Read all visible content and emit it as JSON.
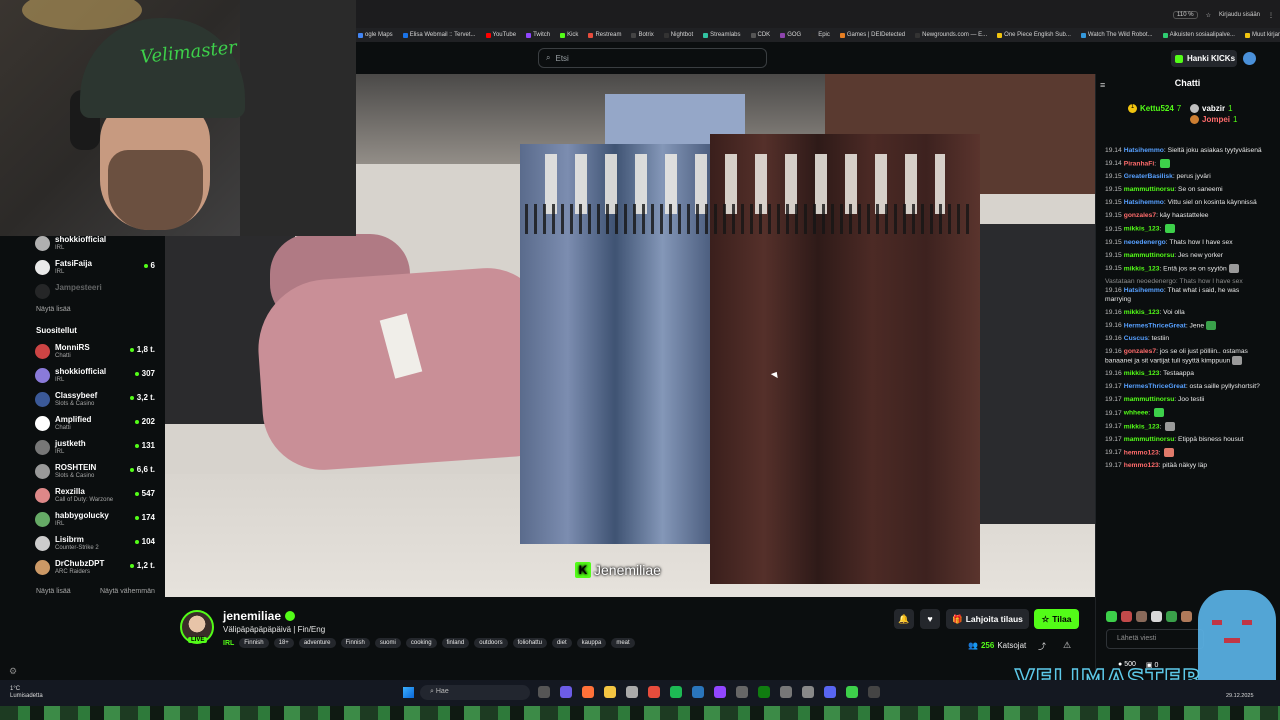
{
  "browser": {
    "zoom": "110 %",
    "signin": "Kirjaudu sisään",
    "bookmarks": [
      "ogle Maps",
      "Elisa Webmail :: Tervet...",
      "YouTube",
      "Twitch",
      "Kick",
      "Restream",
      "Botrix",
      "Nightbot",
      "Streamlabs",
      "CDK",
      "GOG",
      "Epic",
      "Games | DEIDetected",
      "Newgrounds.com — E...",
      "One Piece English Sub...",
      "Watch The Wild Robot...",
      "Aikuisten sosiaalipalve...",
      "Muut kirjanmerkit"
    ]
  },
  "header": {
    "search_placeholder": "Etsi",
    "get_kicks": "Hanki KICKs"
  },
  "webcam": {
    "logo_text": "Velimaster"
  },
  "sidebar": {
    "following": [
      {
        "name": "shokkiofficial",
        "category": "IRL",
        "count": ""
      },
      {
        "name": "FatsiFaija",
        "category": "IRL",
        "count": "6"
      },
      {
        "name": "Jampesteeri",
        "category": "",
        "count": ""
      }
    ],
    "show_more_1": "Näytä lisää",
    "recommended_title": "Suositellut",
    "recommended": [
      {
        "name": "MonniRS",
        "category": "Chatti",
        "count": "1,8 t."
      },
      {
        "name": "shokkiofficial",
        "category": "IRL",
        "count": "307"
      },
      {
        "name": "Classybeef",
        "category": "Slots & Casino",
        "count": "3,2 t."
      },
      {
        "name": "Amplified",
        "category": "Chatti",
        "count": "202"
      },
      {
        "name": "justketh",
        "category": "IRL",
        "count": "131"
      },
      {
        "name": "ROSHTEIN",
        "category": "Slots & Casino",
        "count": "6,6 t."
      },
      {
        "name": "Rexzilla",
        "category": "Call of Duty: Warzone",
        "count": "547"
      },
      {
        "name": "habbygolucky",
        "category": "IRL",
        "count": "174"
      },
      {
        "name": "Lisibrm",
        "category": "Counter-Strike 2",
        "count": "104"
      },
      {
        "name": "DrChubzDPT",
        "category": "ARC Raiders",
        "count": "1,2 t."
      }
    ],
    "show_more_2": "Näytä lisää",
    "show_less": "Näytä vähemmän"
  },
  "video": {
    "watermark": "Jenemiliae"
  },
  "stream": {
    "live_badge": "LIVE",
    "streamer": "jenemiliae",
    "title": "Välipäpäpäpäpäivä | Fin/Eng",
    "category": "IRL",
    "tags": [
      "Finnish",
      "18+",
      "adventure",
      "Finnish",
      "suomi",
      "cooking",
      "finland",
      "outdoors",
      "foliohattu",
      "diet",
      "kauppa",
      "meat"
    ],
    "gift_label": "Lahjoita tilaus",
    "subscribe_label": "Tilaa",
    "viewers_count": "256",
    "viewers_label": "Katsojat"
  },
  "chat": {
    "title": "Chatti",
    "pinned": [
      {
        "rank": "1",
        "name": "Kettu524",
        "score": "7"
      },
      {
        "rank": "",
        "name": "vabzir",
        "score": "1"
      },
      {
        "rank": "",
        "name": "Jompei",
        "score": "1"
      }
    ],
    "messages": [
      {
        "time": "19.14",
        "user": "Hatsihemmo",
        "color": "#57a0ff",
        "text": "Sieltä joku asiakas tyytyväisenä",
        "emote": ""
      },
      {
        "time": "19.14",
        "user": "PiranhaFi",
        "color": "#ff6b6b",
        "text": "",
        "emote": "#3dd04a"
      },
      {
        "time": "19.15",
        "user": "GreaterBasilisk",
        "color": "#57a0ff",
        "text": "perus jyväri",
        "emote": ""
      },
      {
        "time": "19.15",
        "user": "mammuttinorsu",
        "color": "#53fc18",
        "text": "Se on saneemi",
        "emote": ""
      },
      {
        "time": "19.15",
        "user": "Hatsihemmo",
        "color": "#57a0ff",
        "text": "Vittu siel on kosinta käynnissä",
        "emote": ""
      },
      {
        "time": "19.15",
        "user": "gonzales7",
        "color": "#ff6b6b",
        "text": "käy haastattelee",
        "emote": ""
      },
      {
        "time": "19.15",
        "user": "mikkis_123",
        "color": "#53fc18",
        "text": "",
        "emote": "#3dd04a"
      },
      {
        "time": "19.15",
        "user": "neoedenergo",
        "color": "#57a0ff",
        "text": "Thats how I have sex",
        "emote": ""
      },
      {
        "time": "19.15",
        "user": "mammuttinorsu",
        "color": "#53fc18",
        "text": "Jes new yorker",
        "emote": ""
      },
      {
        "time": "19.15",
        "user": "mikkis_123",
        "color": "#53fc18",
        "text": "Entä jos se on syytön",
        "emote": "#9a9a9a"
      },
      {
        "time": "",
        "user": "",
        "color": "#8d8d8d",
        "text": "Vastataan neoedenergo: Thats how I have sex",
        "emote": "",
        "reply": true
      },
      {
        "time": "19.16",
        "user": "Hatsihemmo",
        "color": "#57a0ff",
        "text": "That what i said, he was marrying",
        "emote": ""
      },
      {
        "time": "19.16",
        "user": "mikkis_123",
        "color": "#53fc18",
        "text": "Voi olla",
        "emote": ""
      },
      {
        "time": "19.16",
        "user": "HermesThriceGreat",
        "color": "#57a0ff",
        "text": "Jene",
        "emote": "#3aa04a"
      },
      {
        "time": "19.16",
        "user": "Cuscus",
        "color": "#57a0ff",
        "text": "testiin",
        "emote": ""
      },
      {
        "time": "19.16",
        "user": "gonzales7",
        "color": "#ff6b6b",
        "text": "jos se oli just pölliin.. ostamas banaanei ja sit vartijat tuli syyttä kimppuun",
        "emote": "#9a9a9a"
      },
      {
        "time": "19.16",
        "user": "mikkis_123",
        "color": "#53fc18",
        "text": "Testaappa",
        "emote": ""
      },
      {
        "time": "19.17",
        "user": "HermesThriceGreat",
        "color": "#57a0ff",
        "text": "osta saille pyllyshortsit?",
        "emote": ""
      },
      {
        "time": "19.17",
        "user": "mammuttinorsu",
        "color": "#53fc18",
        "text": "Joo testii",
        "emote": ""
      },
      {
        "time": "19.17",
        "user": "whheee",
        "color": "#53fc18",
        "text": "",
        "emote": "#3dd04a"
      },
      {
        "time": "19.17",
        "user": "mikkis_123",
        "color": "#53fc18",
        "text": "",
        "emote": "#9a9a9a"
      },
      {
        "time": "19.17",
        "user": "mammuttinorsu",
        "color": "#53fc18",
        "text": "Etippä bisness housut",
        "emote": ""
      },
      {
        "time": "19.17",
        "user": "hemmo123",
        "color": "#ff6b6b",
        "text": "",
        "emote": "#e07a6a"
      },
      {
        "time": "19.17",
        "user": "hemmo123",
        "color": "#ff6b6b",
        "text": "pitää näkyy läp",
        "emote": ""
      }
    ],
    "input_placeholder": "Lähetä viesti",
    "points": "500",
    "points2": "0"
  },
  "overlay": {
    "brand": "VELIMASTER"
  },
  "taskbar": {
    "weather_temp": "1°C",
    "weather_desc": "Lumisadetta",
    "search_placeholder": "Hae",
    "date": "29.12.2025"
  },
  "colors": {
    "accent": "#53fc18",
    "background": "#0b0e0f",
    "button_bg": "#24272c"
  }
}
